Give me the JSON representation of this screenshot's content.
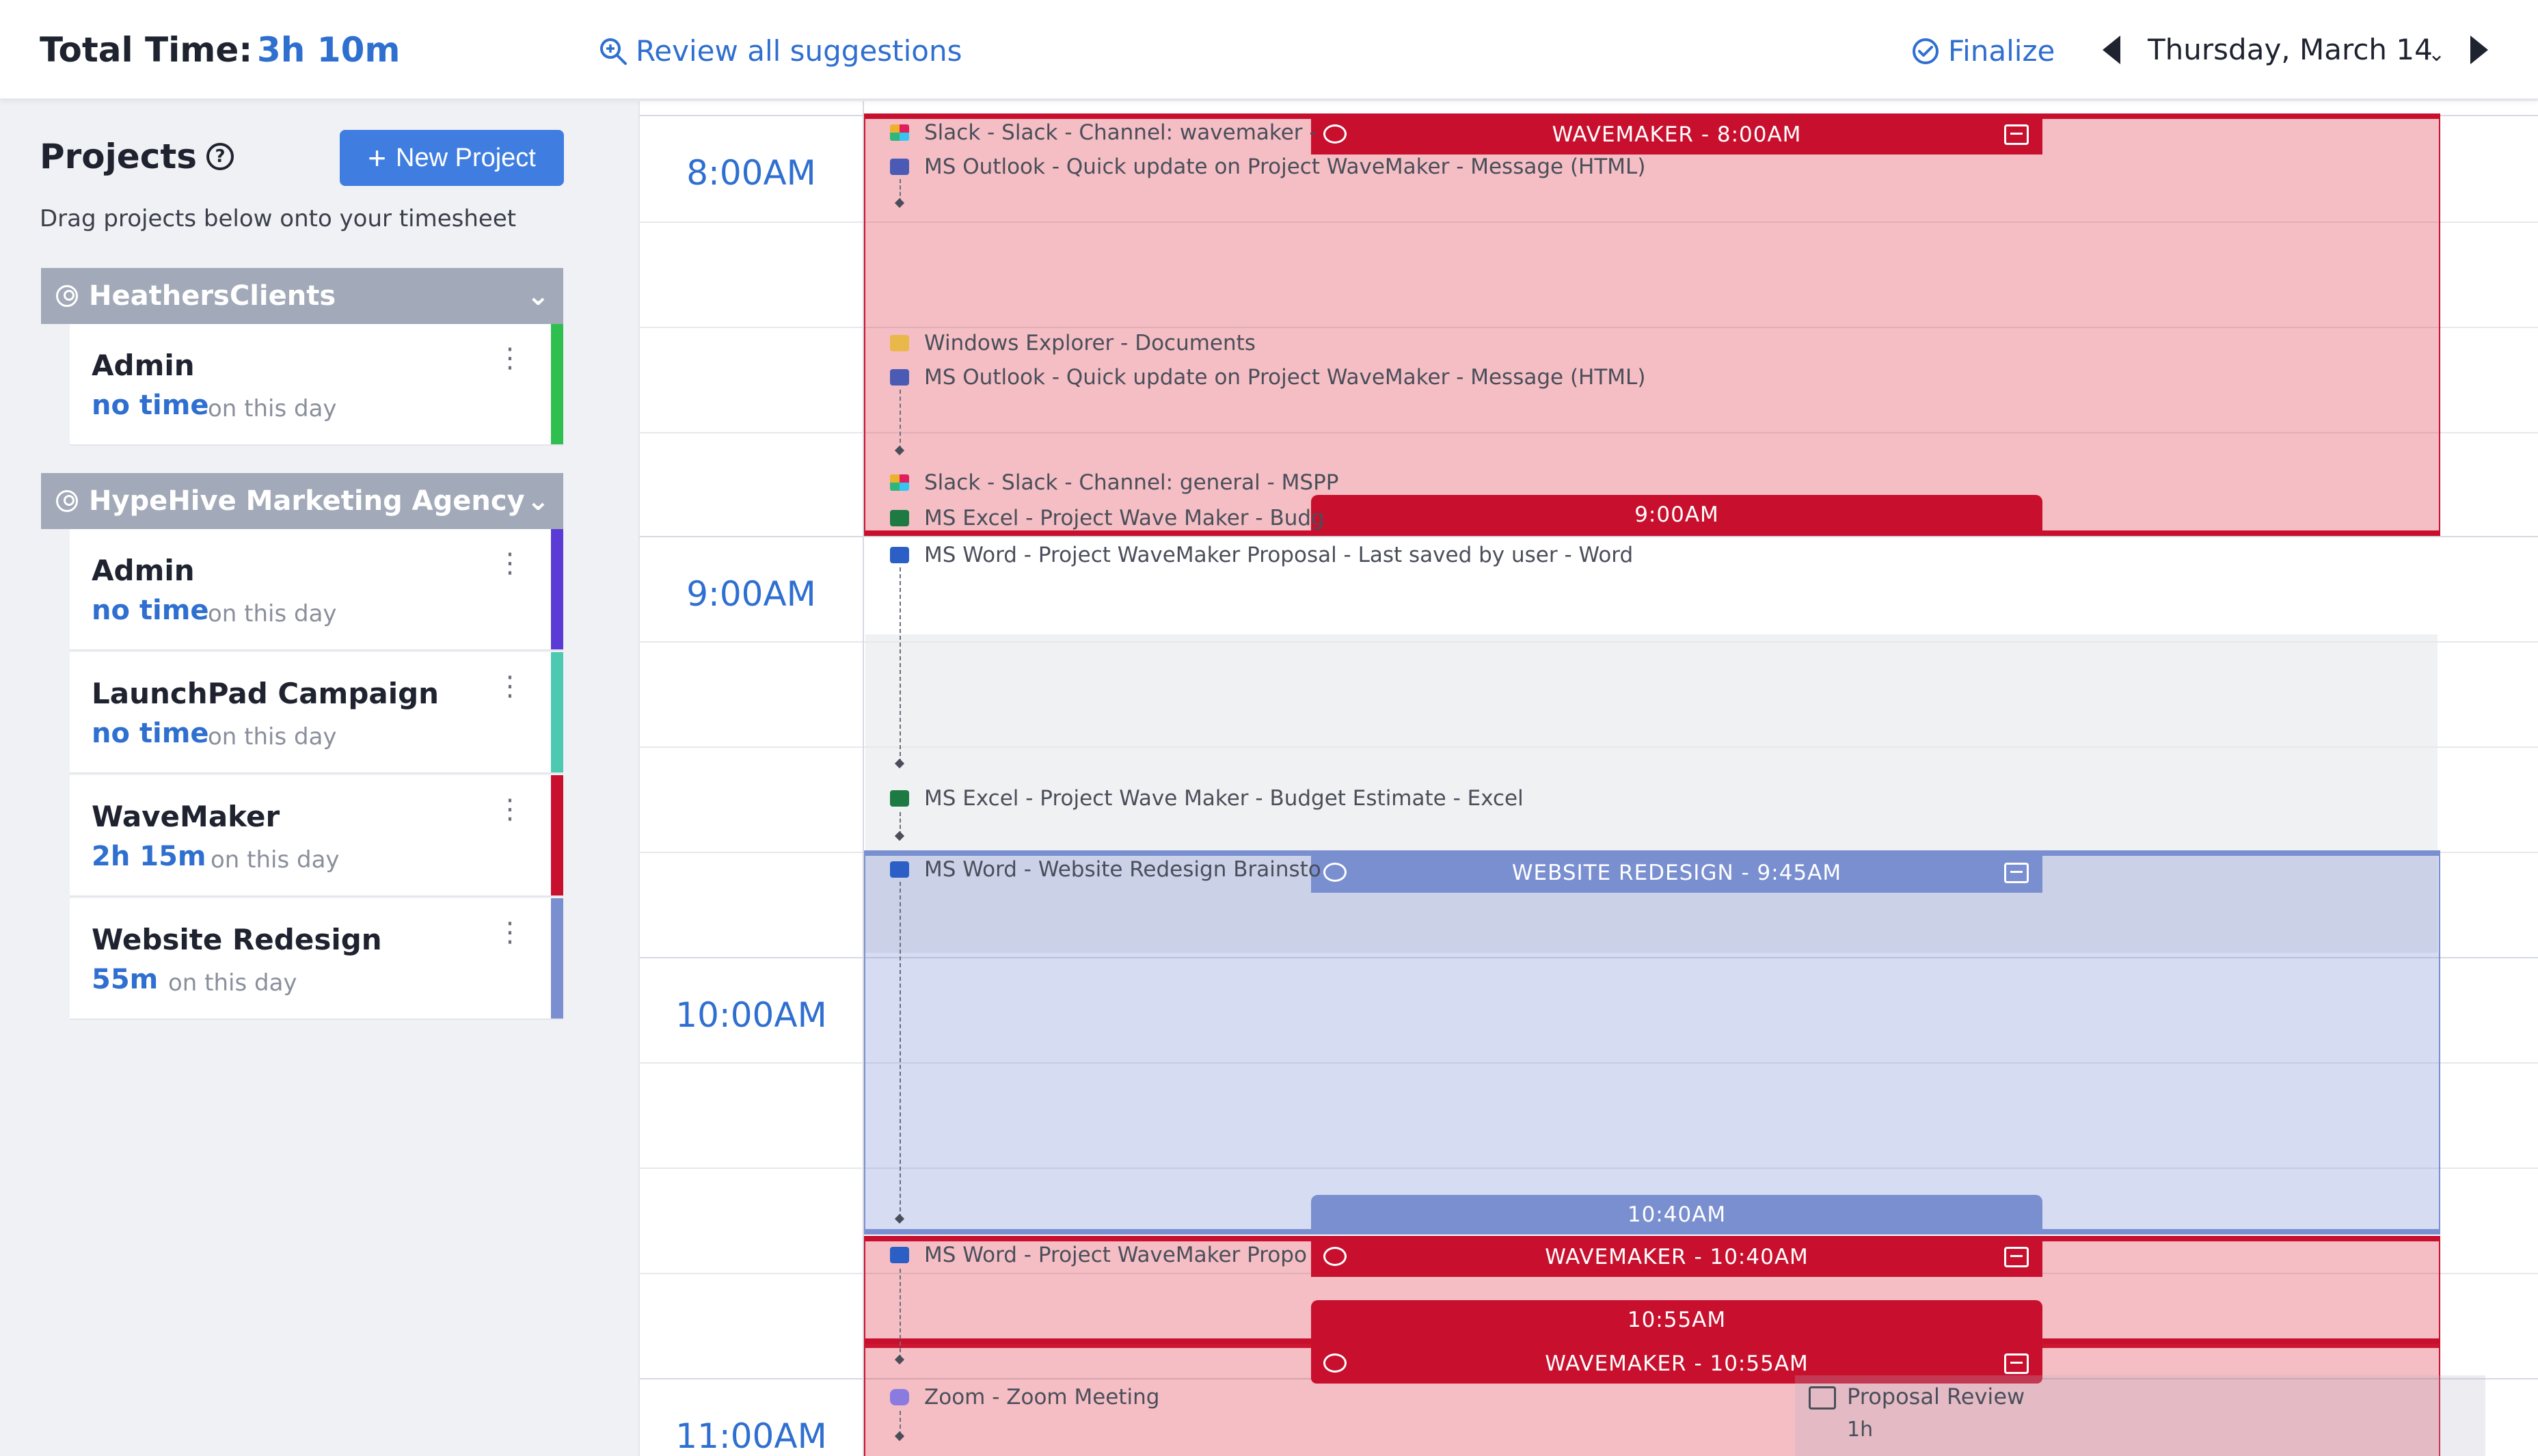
{
  "header": {
    "total_label": "Total Time:",
    "total_value": "3h 10m",
    "review_label": "Review all suggestions",
    "finalize_label": "Finalize",
    "date_label": "Thursday, March 14"
  },
  "sidebar": {
    "title": "Projects",
    "new_project_label": "New Project",
    "drag_hint": "Drag projects below onto your timesheet",
    "suffix": "on this day",
    "clients": [
      {
        "name": "HeathersClients",
        "projects": [
          {
            "name": "Admin",
            "time": "no time",
            "color": "#2fbf4f"
          }
        ]
      },
      {
        "name": "HypeHive Marketing Agency",
        "projects": [
          {
            "name": "Admin",
            "time": "no time",
            "color": "#5a3bd6"
          },
          {
            "name": "LaunchPad Campaign",
            "time": "no time",
            "color": "#4cc9b0"
          },
          {
            "name": "WaveMaker",
            "time": "2h 15m",
            "color": "#c8102e"
          },
          {
            "name": "Website Redesign",
            "time": "55m",
            "color": "#7a8fd0"
          }
        ]
      }
    ]
  },
  "timeline": {
    "hours": [
      "8:00AM",
      "9:00AM",
      "10:00AM",
      "11:00AM"
    ],
    "entries": {
      "wavemaker_800": "WAVEMAKER - 8:00AM",
      "end_900": "9:00AM",
      "website_945": "WEBSITE REDESIGN - 9:45AM",
      "end_1040": "10:40AM",
      "wavemaker_1040": "WAVEMAKER - 10:40AM",
      "end_1055": "10:55AM",
      "wavemaker_1055": "WAVEMAKER - 10:55AM"
    },
    "activities": [
      {
        "app": "slack",
        "text": "Slack - Slack - Channel: wavemaker -"
      },
      {
        "app": "outlook",
        "text": "MS Outlook - Quick update on Project WaveMaker - Message (HTML)"
      },
      {
        "app": "explorer",
        "text": "Windows Explorer - Documents"
      },
      {
        "app": "outlook",
        "text": "MS Outlook - Quick update on Project WaveMaker - Message (HTML)"
      },
      {
        "app": "slack",
        "text": "Slack - Slack - Channel: general - MSPP"
      },
      {
        "app": "excel",
        "text": "MS Excel - Project Wave Maker - Budg"
      },
      {
        "app": "word",
        "text": "MS Word - Project WaveMaker Proposal - Last saved by user - Word"
      },
      {
        "app": "excel",
        "text": "MS Excel - Project Wave Maker - Budget Estimate - Excel"
      },
      {
        "app": "word",
        "text": "MS Word - Website Redesign Brainsto"
      },
      {
        "app": "word",
        "text": "MS Word - Project WaveMaker Propo"
      },
      {
        "app": "zoom",
        "text": "Zoom - Zoom Meeting"
      }
    ],
    "meeting": {
      "name": "Proposal Review",
      "duration": "1h"
    }
  }
}
